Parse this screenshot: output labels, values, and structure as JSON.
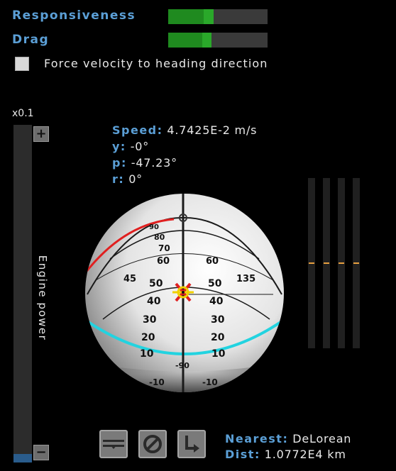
{
  "controls": {
    "responsiveness": {
      "label": "Responsiveness",
      "level": 0.35,
      "level_dark": 0.36,
      "level_bright": 0.1
    },
    "drag": {
      "label": "Drag",
      "level": 0.44
    },
    "force_velocity": {
      "label": "Force velocity to heading direction",
      "checked": false
    }
  },
  "engine": {
    "zoom_label": "x0.1",
    "label": "Engine power",
    "level": 0.025,
    "plus_icon": "plus-icon",
    "minus_icon": "minus-icon"
  },
  "flight": {
    "speed_key": "Speed:",
    "speed_value": "4.7425E-2 m/s",
    "yaw_key": "y:",
    "yaw_value": "-0°",
    "pitch_key": "p:",
    "pitch_value": "-47.23°",
    "roll_key": "r:",
    "roll_value": "0°"
  },
  "navball": {
    "pitch_labels": [
      "90",
      "80",
      "70",
      "60",
      "50",
      "45",
      "40",
      "30",
      "20",
      "10",
      "-10",
      "-90"
    ],
    "heading_labels": [
      "45",
      "135"
    ]
  },
  "buttons": {
    "stabilize_icon": "stabilize-icon",
    "kill_rotation_icon": "no-rotation-icon",
    "turn_icon": "turn-arrow-icon"
  },
  "target": {
    "nearest_key": "Nearest:",
    "nearest_value": "DeLorean",
    "dist_key": "Dist:",
    "dist_value": "1.0772E4 km"
  },
  "colors": {
    "label_blue": "#5b9fd6",
    "bar_green": "#1f8a1f",
    "bar_green_bright": "#2aa82a",
    "engine_fill": "#2a5c8c",
    "horizon_cyan": "#22d3e0",
    "prograde_red": "#e02020",
    "marker_yellow": "#f0d000"
  }
}
